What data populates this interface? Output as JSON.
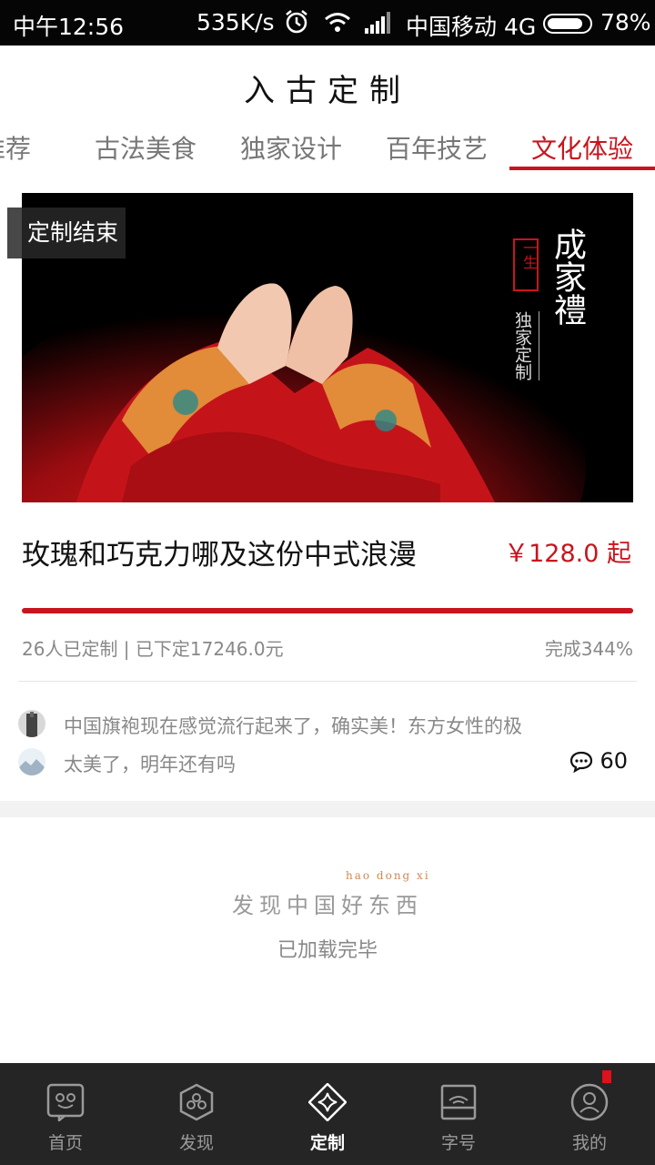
{
  "status_bar": {
    "time": "中午12:56",
    "speed": "535K/s",
    "carrier": "中国移动 4G",
    "battery": "78%"
  },
  "header": {
    "title": "入古定制"
  },
  "tabs": [
    {
      "label": "推荐"
    },
    {
      "label": "古法美食"
    },
    {
      "label": "独家设计"
    },
    {
      "label": "百年技艺"
    },
    {
      "label": "文化体验",
      "active": true
    }
  ],
  "card": {
    "badge": "定制结束",
    "image_caption": {
      "top_seal": "一生",
      "main": "成家禮",
      "sub": "独家定制"
    },
    "title": "玫瑰和巧克力哪及这份中式浪漫",
    "price": "￥128.0 起",
    "progress_percent": 100,
    "stats": "26人已定制 | 已下定17246.0元",
    "complete": "完成344%",
    "comments": [
      {
        "text": "中国旗袍现在感觉流行起来了，确实美！东方女性的极"
      },
      {
        "text": "太美了，明年还有吗"
      }
    ],
    "comment_count": "60"
  },
  "footer": {
    "pinyin": "hao  dong  xi",
    "slogan": "发现中国好东西",
    "loaded": "已加载完毕"
  },
  "bottom_nav": [
    {
      "label": "首页",
      "icon": "home-icon"
    },
    {
      "label": "发现",
      "icon": "discover-icon"
    },
    {
      "label": "定制",
      "icon": "custom-icon",
      "active": true
    },
    {
      "label": "字号",
      "icon": "brand-icon"
    },
    {
      "label": "我的",
      "icon": "profile-icon"
    }
  ],
  "colors": {
    "accent": "#c9141e",
    "nav_bg": "#252525"
  }
}
